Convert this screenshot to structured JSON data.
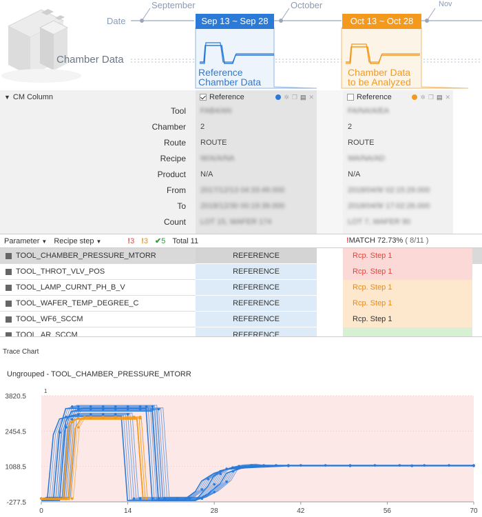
{
  "timeline": {
    "date_label": "Date",
    "months": [
      "September",
      "October",
      "Nov"
    ],
    "reference_range": "Sep 13 ~ Sep 28",
    "analyzed_range": "Oct 13 ~ Oct 28",
    "reference_caption_line1": "Reference",
    "reference_caption_line2": "Chamber Data",
    "analyzed_caption_line1": "Chamber Data",
    "analyzed_caption_line2": "to be Analyzed",
    "chamber_data_label": "Chamber Data",
    "colors": {
      "reference": "#2b7ad8",
      "analyzed": "#f39a1e"
    }
  },
  "cm": {
    "column_title": "CM Column",
    "reference_header": "Reference",
    "analyzed_header": "Reference",
    "fields": [
      {
        "label": "Tool",
        "reference": "FAB4/AN",
        "analyzed": "FA/NA/A/EA"
      },
      {
        "label": "Chamber",
        "reference": "2",
        "analyzed": "2"
      },
      {
        "label": "Route",
        "reference": "ROUTE",
        "analyzed": "ROUTE"
      },
      {
        "label": "Recipe",
        "reference": "W/A/A/NA",
        "analyzed": "WA/NA/AD"
      },
      {
        "label": "Product",
        "reference": "N/A",
        "analyzed": "N/A"
      },
      {
        "label": "From",
        "reference": "2017/12/13 04:33:49.000",
        "analyzed": "2018/04/9/ 02:15:29.000"
      },
      {
        "label": "To",
        "reference": "2018/12/30 00:19:39.000",
        "analyzed": "2018/04/9/ 17:02:26.000"
      },
      {
        "label": "Count",
        "reference": "LOT 15, WAFER 174",
        "analyzed": "LOT 7, WAFER 90"
      }
    ]
  },
  "params": {
    "parameter_label": "Parameter",
    "recipe_step_label": "Recipe step",
    "count_red": "3",
    "count_orange": "3",
    "count_green": "5",
    "total": "Total 11",
    "match_label": "MATCH 72.73%",
    "match_count": "( 8/11 )",
    "rows": [
      {
        "name": "TOOL_CHAMBER_PRESSURE_MTORR",
        "reference": "REFERENCE",
        "analyzed": "Rcp. Step 1",
        "status_color": "#fbd9d6",
        "text_color": "#e0463c"
      },
      {
        "name": "TOOL_THROT_VLV_POS",
        "reference": "REFERENCE",
        "analyzed": "Rcp. Step 1",
        "status_color": "#fbd9d6",
        "text_color": "#e0463c"
      },
      {
        "name": "TOOL_LAMP_CURNT_PH_B_V",
        "reference": "REFERENCE",
        "analyzed": "Rcp. Step 1",
        "status_color": "#fde7cd",
        "text_color": "#e88a1a"
      },
      {
        "name": "TOOL_WAFER_TEMP_DEGREE_C",
        "reference": "REFERENCE",
        "analyzed": "Rcp. Step 1",
        "status_color": "#fde7cd",
        "text_color": "#e88a1a"
      },
      {
        "name": "TOOL_WF6_SCCM",
        "reference": "REFERENCE",
        "analyzed": "Rcp. Step 1",
        "status_color": "#fde7cd",
        "text_color": "#333333"
      },
      {
        "name": "TOOL_AR_SCCM",
        "reference": "REFERENCE",
        "analyzed": "",
        "status_color": "#d7efd3",
        "text_color": "#333333"
      }
    ]
  },
  "chart": {
    "title": "Trace Chart",
    "subtitle": "Ungrouped - TOOL_CHAMBER_PRESSURE_MTORR",
    "corner_label": "1"
  },
  "chart_data": {
    "type": "line",
    "title": "Ungrouped - TOOL_CHAMBER_PRESSURE_MTORR",
    "xlabel": "",
    "ylabel": "",
    "xlim": [
      0,
      70
    ],
    "ylim": [
      -277.5,
      3820.5
    ],
    "x_ticks": [
      0,
      14,
      28,
      42,
      56,
      70
    ],
    "y_ticks": [
      -277.5,
      1088.5,
      2454.5,
      3820.5
    ],
    "background_band": "#fde8e8",
    "series": [
      {
        "color": "#2b7ad8",
        "x": [
          0,
          3,
          4,
          5,
          6,
          8,
          10,
          12,
          14,
          16,
          17,
          18,
          19,
          20,
          22,
          24,
          26,
          28,
          29,
          30,
          32,
          34,
          36,
          38,
          40,
          42,
          46,
          50,
          54,
          58,
          62,
          66,
          70
        ],
        "y": [
          -150,
          -150,
          2600,
          3400,
          3400,
          3400,
          3400,
          3400,
          3400,
          3400,
          3400,
          3400,
          -150,
          -150,
          -150,
          -150,
          -150,
          400,
          800,
          1000,
          1100,
          1130,
          1130,
          1130,
          1130,
          1130,
          1130,
          1130,
          1130,
          1130,
          1130,
          1130,
          1130
        ]
      },
      {
        "color": "#2b7ad8",
        "x": [
          0,
          4,
          5,
          6,
          8,
          10,
          12,
          14,
          16,
          18,
          19,
          20,
          22,
          24,
          26,
          28,
          30,
          31,
          33,
          36,
          40,
          50,
          60,
          70
        ],
        "y": [
          -150,
          -150,
          2900,
          3300,
          3300,
          3300,
          3300,
          3300,
          3300,
          3300,
          3300,
          -150,
          -150,
          -150,
          -150,
          100,
          500,
          900,
          1080,
          1120,
          1120,
          1120,
          1120,
          1120
        ]
      },
      {
        "color": "#2b7ad8",
        "x": [
          0,
          2,
          3,
          4,
          6,
          8,
          10,
          12,
          14,
          15,
          16,
          18,
          20,
          22,
          24,
          26,
          27,
          29,
          31,
          34,
          40,
          50,
          60,
          70
        ],
        "y": [
          -150,
          -150,
          2400,
          3000,
          3100,
          3100,
          3100,
          3100,
          3100,
          -150,
          -150,
          -150,
          -150,
          -150,
          -150,
          200,
          600,
          900,
          1050,
          1110,
          1110,
          1110,
          1110,
          1110
        ]
      },
      {
        "color": "#f39a1e",
        "x": [
          0,
          5,
          6,
          7,
          8,
          10,
          12,
          14,
          15,
          16,
          17
        ],
        "y": [
          -150,
          -150,
          2600,
          3000,
          3000,
          3000,
          3000,
          3000,
          3000,
          3000,
          -150
        ]
      },
      {
        "color": "#f39a1e",
        "x": [
          0,
          4,
          5,
          6,
          8,
          10,
          12,
          14,
          16,
          17
        ],
        "y": [
          -150,
          -150,
          2800,
          2950,
          2950,
          2950,
          2950,
          2950,
          2950,
          -150
        ]
      }
    ]
  }
}
